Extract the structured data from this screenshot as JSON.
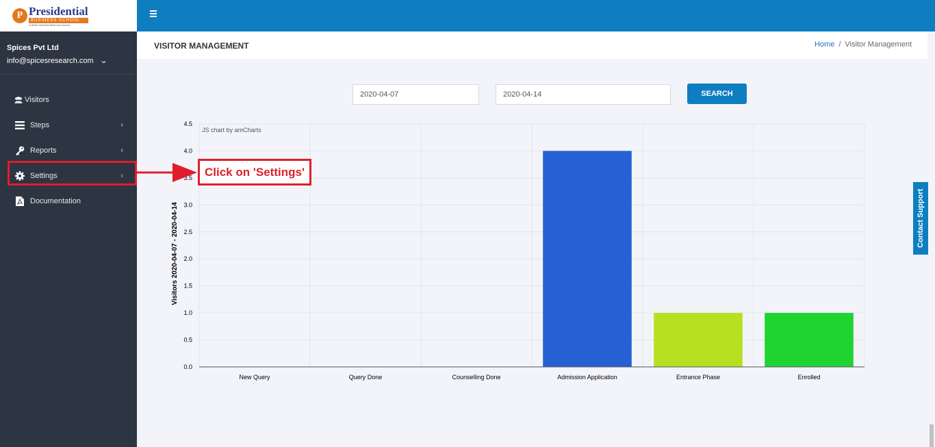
{
  "logo": {
    "letter": "P",
    "main": "Presidential",
    "sub": "BUSINESS SCHOOL",
    "tag": "A Skills Oriented Business School"
  },
  "user": {
    "company": "Spices Pvt Ltd",
    "email": "info@spicesresearch.com"
  },
  "menu": [
    {
      "label": "Visitors",
      "icon": "users-icon"
    },
    {
      "label": "Steps",
      "icon": "bars-icon"
    },
    {
      "label": "Reports",
      "icon": "key-icon"
    },
    {
      "label": "Settings",
      "icon": "gear-icon"
    },
    {
      "label": "Documentation",
      "icon": "file-pdf-icon"
    }
  ],
  "header": {
    "title": "VISITOR MANAGEMENT",
    "breadcrumb_home": "Home",
    "breadcrumb_sep": "/",
    "breadcrumb_current": "Visitor Management"
  },
  "filters": {
    "from_date": "2020-04-07",
    "to_date": "2020-04-14",
    "search_label": "SEARCH"
  },
  "annotation": {
    "text": "Click on 'Settings'"
  },
  "contact_support": "Contact Support",
  "chart_data": {
    "type": "bar",
    "credit": "JS chart by amCharts",
    "categories": [
      "New Query",
      "Query Done",
      "Counselling Done",
      "Admission Application",
      "Entrance Phase",
      "Enrolled"
    ],
    "values": [
      0,
      0,
      0,
      4,
      1,
      1
    ],
    "colors": [
      "#67b7dc",
      "#6794dc",
      "#6771dc",
      "#2561d4",
      "#b7e021",
      "#1fd330"
    ],
    "ylabel": "Visitors 2020-04-07 - 2020-04-14",
    "ylim": [
      0,
      4.5
    ],
    "yticks": [
      "0.0",
      "0.5",
      "1.0",
      "1.5",
      "2.0",
      "2.5",
      "3.0",
      "3.5",
      "4.0",
      "4.5"
    ],
    "grid": true
  },
  "colors": {
    "primary": "#0e7ec1",
    "sidebar": "#2c3541",
    "highlight": "#e01e2b"
  }
}
